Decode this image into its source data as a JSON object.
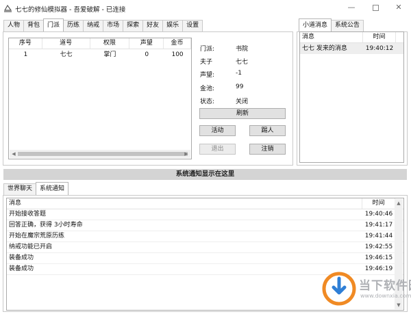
{
  "window": {
    "title": "七七的修仙模拟器 - 吾爱破解 - 已连接",
    "min_glyph": "—",
    "close_glyph": "✕"
  },
  "main_tabs": [
    "人物",
    "背包",
    "门派",
    "历练",
    "纳戒",
    "市场",
    "探索",
    "好友",
    "娱乐",
    "设置"
  ],
  "active_main_tab": "门派",
  "member_table": {
    "columns": [
      "序号",
      "道号",
      "权限",
      "声望",
      "金币"
    ],
    "rows": [
      {
        "index": "1",
        "name": "七七",
        "role": "掌门",
        "prestige": "0",
        "gold": "100"
      }
    ]
  },
  "sect_info": {
    "sect_label": "门派:",
    "sect_value": "书院",
    "master_label": "夫子",
    "master_value": "七七",
    "prestige_label": "声望:",
    "prestige_value": "-1",
    "pool_label": "金池:",
    "pool_value": "99",
    "status_label": "状态:",
    "status_value": "关闭"
  },
  "buttons": {
    "refresh": "刷新",
    "activity": "活动",
    "kick": "踢人",
    "quit": "退出",
    "dissolve": "注销"
  },
  "right_tabs": [
    "小道消息",
    "系统公告"
  ],
  "active_right_tab": "小道消息",
  "gossip_table": {
    "columns": [
      "消息",
      "时间"
    ],
    "rows": [
      {
        "message": "七七 发来的消息",
        "time": "19:40:12"
      }
    ]
  },
  "banner": "系统通知显示在这里",
  "bottom_tabs": [
    "世界聊天",
    "系统通知"
  ],
  "active_bottom_tab": "系统通知",
  "notice_table": {
    "columns": [
      "消息",
      "时间"
    ],
    "rows": [
      {
        "message": "开始接收答题",
        "time": "19:40:46"
      },
      {
        "message": "回答正确，获得 3小时寿命",
        "time": "19:41:17"
      },
      {
        "message": "开始在魔宗荒原历练",
        "time": "19:41:44"
      },
      {
        "message": "纳戒功能已开启",
        "time": "19:42:55"
      },
      {
        "message": "装备成功",
        "time": "19:46:15"
      },
      {
        "message": "装备成功",
        "time": "19:46:19"
      }
    ]
  },
  "watermark": {
    "name": "当下软件园",
    "url": "www.downxia.com",
    "colors": {
      "logo_orange": "#f08a24",
      "logo_blue": "#2f7fd6",
      "text": "#aeb0b4"
    }
  }
}
